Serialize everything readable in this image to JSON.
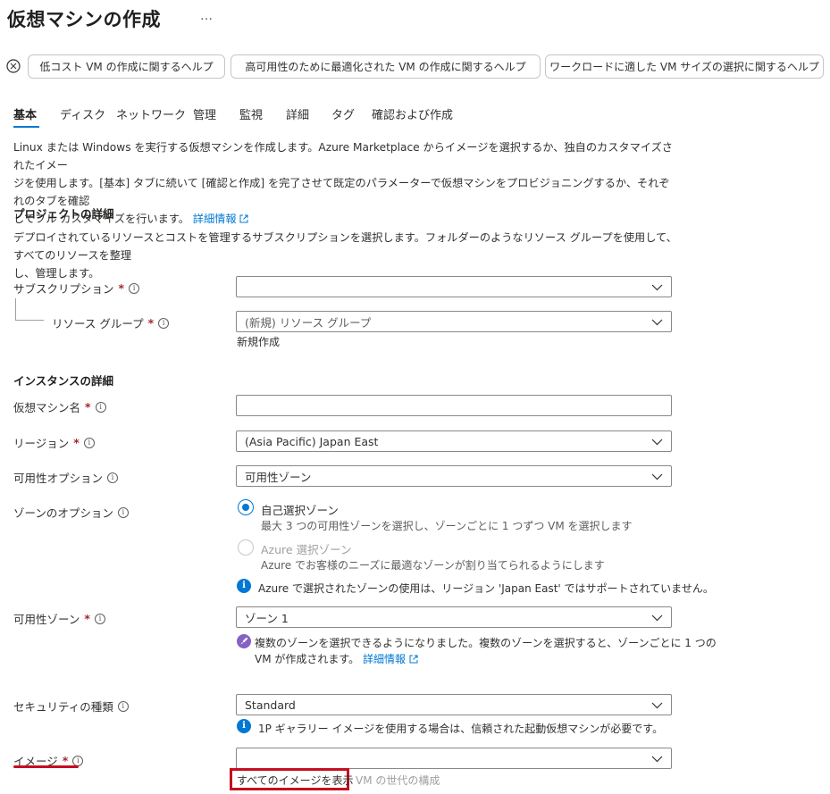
{
  "page": {
    "title": "仮想マシンの作成",
    "more": "…"
  },
  "help_buttons": [
    "低コスト VM の作成に関するヘルプ",
    "高可用性のために最適化された VM の作成に関するヘルプ",
    "ワークロードに適した VM サイズの選択に関するヘルプ"
  ],
  "tabs": [
    "基本",
    "ディスク",
    "ネットワーク",
    "管理",
    "監視",
    "詳細",
    "タグ",
    "確認および作成"
  ],
  "intro": {
    "line1": "Linux または Windows を実行する仮想マシンを作成します。Azure Marketplace からイメージを選択するか、独自のカスタマイズされたイメー",
    "line2": "ジを使用します。[基本] タブに続いて [確認と作成] を完了させて既定のパラメーターで仮想マシンをプロビジョニングするか、それぞれのタブを確認",
    "line3": "してフル カスタマイズを行います。",
    "link": "詳細情報"
  },
  "project": {
    "heading": "プロジェクトの詳細",
    "desc_line1": "デプロイされているリソースとコストを管理するサブスクリプションを選択します。フォルダーのようなリソース グループを使用して、すべてのリソースを整理",
    "desc_line2": "し、管理します。",
    "subscription_label": "サブスクリプション",
    "subscription_value": "",
    "rg_label": "リソース グループ",
    "rg_value": "(新規) リソース グループ",
    "rg_create_link": "新規作成"
  },
  "instance": {
    "heading": "インスタンスの詳細",
    "vm_name_label": "仮想マシン名",
    "vm_name_value": "",
    "region_label": "リージョン",
    "region_value": "(Asia Pacific) Japan East",
    "availability_option_label": "可用性オプション",
    "availability_option_value": "可用性ゾーン",
    "zone_option_label": "ゾーンのオプション",
    "zone_self_title": "自己選択ゾーン",
    "zone_self_desc": "最大 3 つの可用性ゾーンを選択し、ゾーンごとに 1 つずつ VM を選択します",
    "zone_azure_title": "Azure 選択ゾーン",
    "zone_azure_desc": "Azure でお客様のニーズに最適なゾーンが割り当てられるようにします",
    "zone_info": "Azure で選択されたゾーンの使用は、リージョン 'Japan East' ではサポートされていません。",
    "availability_zone_label": "可用性ゾーン",
    "availability_zone_value": "ゾーン 1",
    "multi_zone_note_line1": "複数のゾーンを選択できるようになりました。複数のゾーンを選択すると、ゾーンごとに 1 つの",
    "multi_zone_note_line2": "VM が作成されます。",
    "multi_zone_link": "詳細情報",
    "security_label": "セキュリティの種類",
    "security_value": "Standard",
    "security_info": "1P ギャラリー イメージを使用する場合は、信頼された起動仮想マシンが必要です。",
    "image_label": "イメージ",
    "image_value": "",
    "see_all_images": "すべてのイメージを表示",
    "vm_generation": "VM の世代の構成"
  },
  "colors": {
    "accent": "#0078d4",
    "required": "#a4262c",
    "highlight": "#c50f1f",
    "info": "#0078d4",
    "rocket": "#8661c5"
  }
}
